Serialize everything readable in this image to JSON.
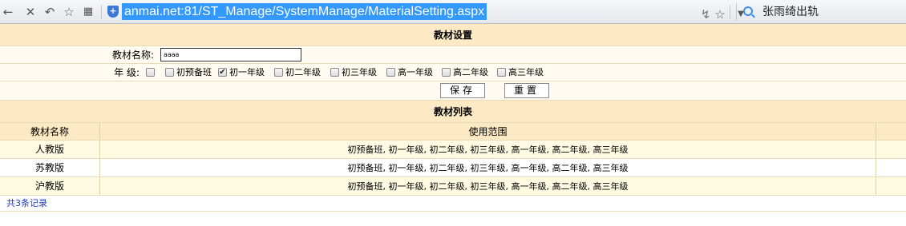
{
  "browser": {
    "url": "anmai.net:81/ST_Manage/SystemManage/MaterialSetting.aspx",
    "search_text": "张雨绮出轨"
  },
  "settings": {
    "title": "教材设置",
    "name_label": "教材名称:",
    "name_value": "aaaa",
    "grade_label": "年 级:",
    "grades": [
      {
        "label": "初预备班",
        "checked": false
      },
      {
        "label": "初一年级",
        "checked": true
      },
      {
        "label": "初二年级",
        "checked": false
      },
      {
        "label": "初三年级",
        "checked": false
      },
      {
        "label": "高一年级",
        "checked": false
      },
      {
        "label": "高二年级",
        "checked": false
      },
      {
        "label": "高三年级",
        "checked": false
      }
    ],
    "save_label": "保存",
    "reset_label": "重置"
  },
  "list": {
    "title": "教材列表",
    "columns": [
      "教材名称",
      "使用范围"
    ],
    "rows": [
      {
        "name": "人教版",
        "scope": "初预备班, 初一年级, 初二年级, 初三年级, 高一年级, 高二年级, 高三年级"
      },
      {
        "name": "苏教版",
        "scope": "初预备班, 初一年级, 初二年级, 初三年级, 高一年级, 高二年级, 高三年级"
      },
      {
        "name": "沪教版",
        "scope": "初预备班, 初一年级, 初二年级, 初三年级, 高一年级, 高二年级, 高三年级"
      }
    ],
    "record_count": "共3条记录"
  }
}
